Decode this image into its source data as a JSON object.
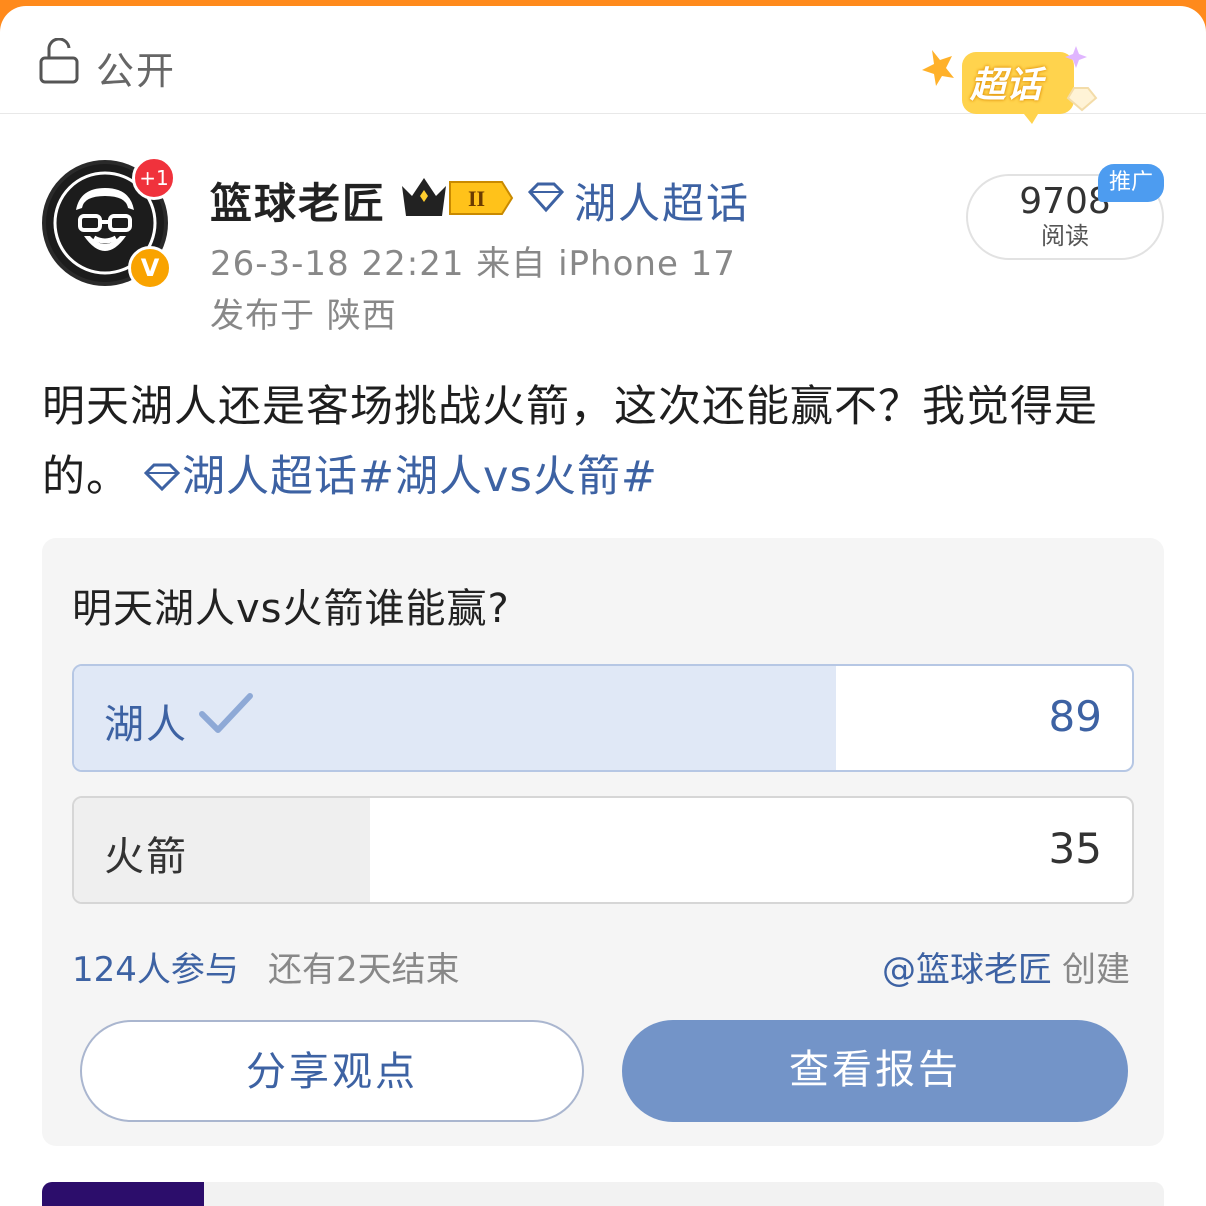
{
  "top_bar": {
    "visibility_label": "公开",
    "badge_label": "超话"
  },
  "author": {
    "name": "篮球老匠",
    "badge_count": "+1",
    "verified_mark": "V",
    "supertopic": "湖人超话",
    "time_source": "26-3-18 22:21  来自 iPhone 17",
    "location": "发布于 陕西"
  },
  "reads": {
    "count": "9708",
    "label": "阅读",
    "promo_tag": "推广"
  },
  "post": {
    "text": "明天湖人还是客场挑战火箭，这次还能赢不？我觉得是的。",
    "topic_link": "湖人超话",
    "hashtag": "#湖人vs火箭#"
  },
  "poll": {
    "question": "明天湖人vs火箭谁能赢?",
    "options": [
      {
        "label": "湖人",
        "count": "89",
        "share": 0.72,
        "selected": true
      },
      {
        "label": "火箭",
        "count": "35",
        "share": 0.28,
        "selected": false
      }
    ],
    "participants": "124人参与",
    "remaining": "还有2天结束",
    "creator_mention": "@篮球老匠",
    "creator_suffix": "创建",
    "share_button": "分享观点",
    "report_button": "查看报告"
  },
  "colors": {
    "accent": "#3d62a3",
    "brand_orange": "#ff8a1c",
    "selected_fill": "#e0e8f6",
    "report_button": "#7394c8"
  },
  "icons": [
    "lock-icon",
    "chaohua-badge-icon",
    "crown-level-icon",
    "gem-icon",
    "check-icon",
    "avatar-icon"
  ]
}
